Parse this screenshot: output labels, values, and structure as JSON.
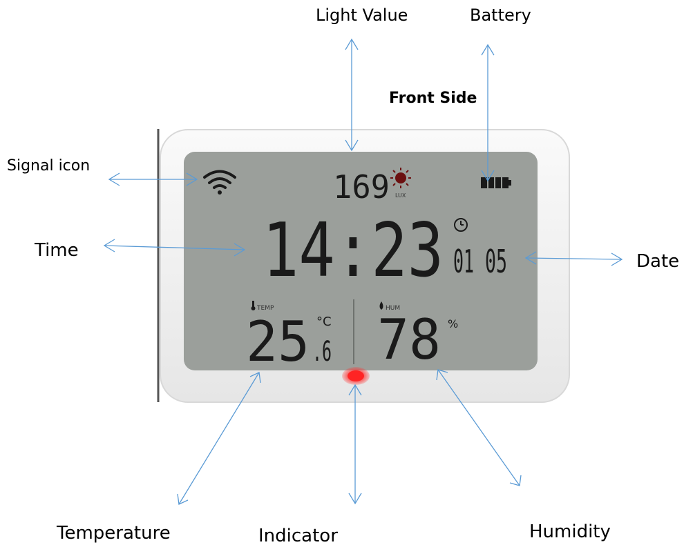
{
  "title": "Front Side",
  "labels": {
    "light_value": "Light Value",
    "battery": "Battery",
    "signal_icon": "Signal icon",
    "time": "Time",
    "date": "Date",
    "temperature": "Temperature",
    "indicator": "Indicator",
    "humidity": "Humidity"
  },
  "display": {
    "light_value": "169",
    "light_unit": "LUX",
    "time": "14:23",
    "date_month": "01",
    "date_day": "05",
    "temp_label": "TEMP",
    "temperature_int": "25",
    "temperature_dec": ".6",
    "temp_unit": "°C",
    "hum_label": "HUM",
    "humidity": "78",
    "humidity_unit": "%"
  },
  "colors": {
    "arrow": "#5b9bd5",
    "lcd_bg": "#9a9e9a",
    "lcd_text": "#1a1a1a",
    "device_frame": "#f2f2f2",
    "indicator": "#ff2a2a"
  },
  "icons": [
    "wifi-icon",
    "sun-icon",
    "battery-icon",
    "clock-icon",
    "thermometer-icon",
    "droplet-icon"
  ]
}
